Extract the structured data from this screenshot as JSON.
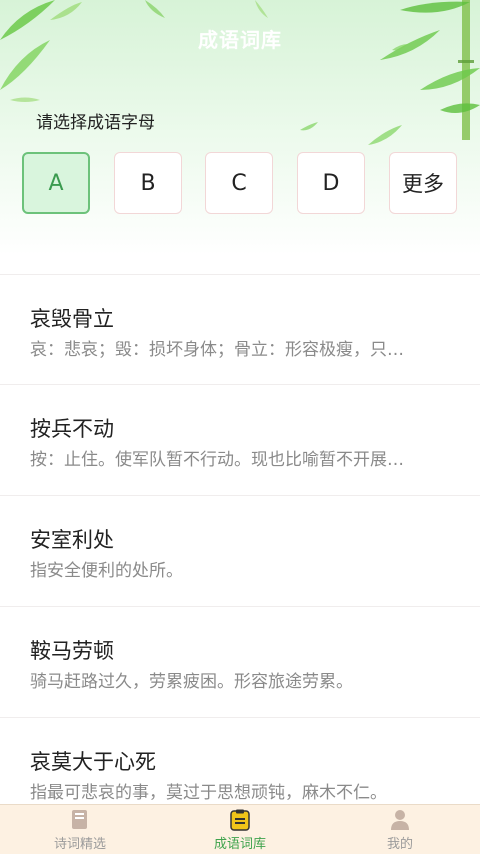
{
  "header": {
    "title": "成语词库",
    "prompt": "请选择成语字母"
  },
  "letters": [
    {
      "label": "A",
      "selected": true
    },
    {
      "label": "B",
      "selected": false
    },
    {
      "label": "C",
      "selected": false
    },
    {
      "label": "D",
      "selected": false
    },
    {
      "label": "更多",
      "selected": false
    }
  ],
  "idioms": [
    {
      "name": "哀毁骨立",
      "desc": "哀：悲哀；毁：损坏身体；骨立：形容极瘦，只…"
    },
    {
      "name": "按兵不动",
      "desc": "按：止住。使军队暂不行动。现也比喻暂不开展…"
    },
    {
      "name": "安室利处",
      "desc": "指安全便利的处所。"
    },
    {
      "name": "鞍马劳顿",
      "desc": "骑马赶路过久，劳累疲困。形容旅途劳累。"
    },
    {
      "name": "哀莫大于心死",
      "desc": "指最可悲哀的事，莫过于思想顽钝，麻木不仁。"
    }
  ],
  "tabs": [
    {
      "label": "诗词精选",
      "icon": "book-icon",
      "active": false
    },
    {
      "label": "成语词库",
      "icon": "clipboard-icon",
      "active": true
    },
    {
      "label": "我的",
      "icon": "person-icon",
      "active": false
    }
  ],
  "colors": {
    "accent": "#3fa34d",
    "selected_bg": "#d9f5dd",
    "tabbar_bg": "#fdf1e2"
  }
}
